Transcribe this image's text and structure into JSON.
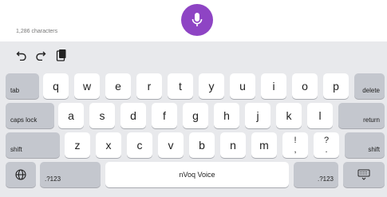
{
  "editor": {
    "char_count": "1,286 characters"
  },
  "toolbar": {
    "undo_icon": "undo-icon",
    "redo_icon": "redo-icon",
    "paste_icon": "clipboard-icon"
  },
  "mic": {
    "icon": "microphone-icon",
    "color": "#8e44c4"
  },
  "keyboard": {
    "row1": [
      "q",
      "w",
      "e",
      "r",
      "t",
      "y",
      "u",
      "i",
      "o",
      "p"
    ],
    "row2": [
      "a",
      "s",
      "d",
      "f",
      "g",
      "h",
      "j",
      "k",
      "l"
    ],
    "row3": [
      "z",
      "x",
      "c",
      "v",
      "b",
      "n",
      "m"
    ],
    "tab": "tab",
    "delete": "delete",
    "caps_lock": "caps lock",
    "return": "return",
    "shift_left": "shift",
    "shift_right": "shift",
    "excl": {
      "top": "!",
      "bottom": ","
    },
    "quest": {
      "top": "?",
      "bottom": "."
    },
    "numbers_left": ".?123",
    "numbers_right": ".?123",
    "space": "nVoq Voice",
    "globe_icon": "globe-icon",
    "hide_keyboard_icon": "keyboard-icon"
  }
}
